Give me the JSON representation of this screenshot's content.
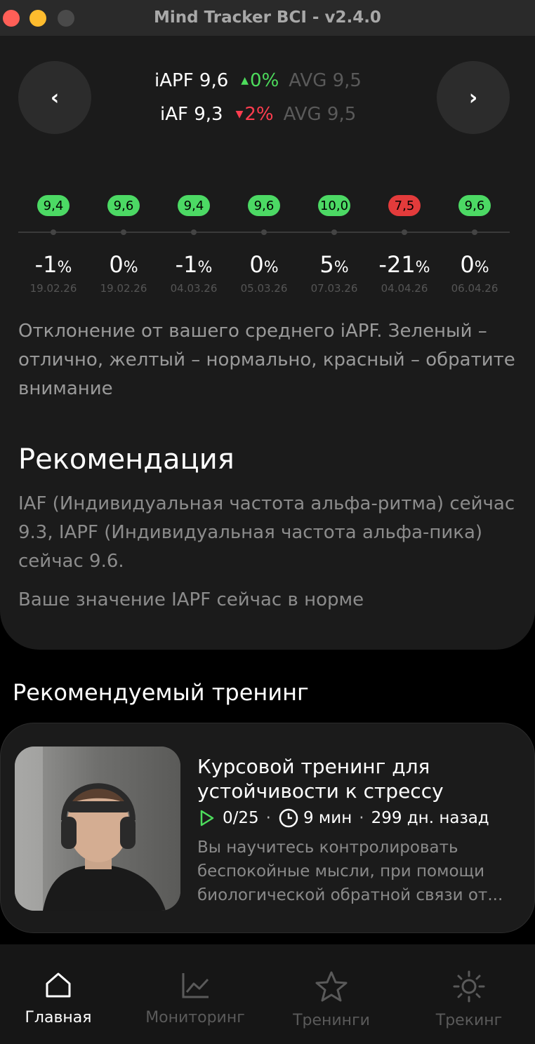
{
  "window": {
    "title": "Mind Tracker BCI - v2.4.0"
  },
  "header": {
    "metrics": [
      {
        "name": "iAPF 9,6",
        "change": "0%",
        "direction": "up",
        "avg": "AVG 9,5"
      },
      {
        "name": "iAF 9,3",
        "change": "2%",
        "direction": "down",
        "avg": "AVG 9,5"
      }
    ],
    "prev_label": "‹",
    "next_label": "›"
  },
  "timeline": [
    {
      "value": "9,4",
      "status": "green",
      "pct": "-1",
      "date": "19.02.26"
    },
    {
      "value": "9,6",
      "status": "green",
      "pct": "0",
      "date": "19.02.26"
    },
    {
      "value": "9,4",
      "status": "green",
      "pct": "-1",
      "date": "04.03.26"
    },
    {
      "value": "9,6",
      "status": "green",
      "pct": "0",
      "date": "05.03.26"
    },
    {
      "value": "10,0",
      "status": "green",
      "pct": "5",
      "date": "07.03.26"
    },
    {
      "value": "7,5",
      "status": "red",
      "pct": "-21",
      "date": "04.04.26"
    },
    {
      "value": "9,6",
      "status": "green",
      "pct": "0",
      "date": "06.04.26"
    }
  ],
  "percent_sign": "%",
  "description": "Отклонение от вашего среднего iAPF. Зеленый – отлично, желтый – нормально, красный – обратите внимание",
  "recommendation": {
    "heading": "Рекомендация",
    "text": "IAF (Индивидуальная частота альфа-ритма) сейчас 9.3, IAPF (Индивидуальная частота альфа-пика) сейчас 9.6.",
    "status": "Ваше значение IAPF сейчас в норме"
  },
  "training_section": {
    "heading": "Рекомендуемый тренинг",
    "card": {
      "title": "Курсовой тренинг для устойчивости к стрессу",
      "progress": "0/25",
      "duration": "9 мин",
      "ago": "299 дн. назад",
      "separator": "·",
      "description": "Вы научитесь контролировать беспокойные мысли, при помощи биологической обратной связи от..."
    }
  },
  "bottom_nav": [
    {
      "label": "Главная",
      "icon": "home-icon",
      "active": true
    },
    {
      "label": "Мониторинг",
      "icon": "chart-icon",
      "active": false
    },
    {
      "label": "Тренинги",
      "icon": "star-icon",
      "active": false
    },
    {
      "label": "Трекинг",
      "icon": "sun-icon",
      "active": false
    }
  ],
  "colors": {
    "green": "#4cd964",
    "red": "#e33b3b",
    "up": "#4ddc5c",
    "down": "#ff3d4f"
  }
}
